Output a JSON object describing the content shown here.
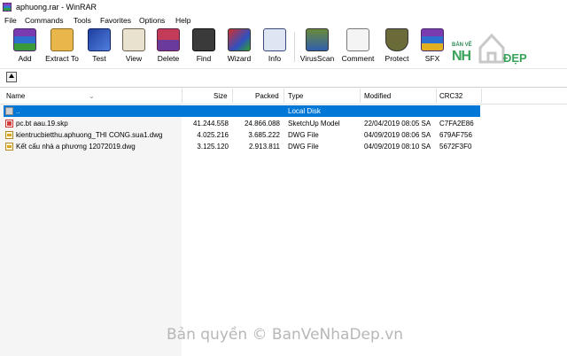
{
  "window": {
    "title": "aphuong.rar - WinRAR"
  },
  "menu": [
    "File",
    "Commands",
    "Tools",
    "Favorites",
    "Options",
    "Help"
  ],
  "toolbar": [
    {
      "label": "Add",
      "icon": "add-icon"
    },
    {
      "label": "Extract To",
      "icon": "extract-icon"
    },
    {
      "label": "Test",
      "icon": "test-icon"
    },
    {
      "label": "View",
      "icon": "view-icon"
    },
    {
      "label": "Delete",
      "icon": "delete-icon"
    },
    {
      "label": "Find",
      "icon": "find-icon"
    },
    {
      "label": "Wizard",
      "icon": "wizard-icon"
    },
    {
      "label": "Info",
      "icon": "info-icon"
    },
    {
      "label": "VirusScan",
      "icon": "virusscan-icon"
    },
    {
      "label": "Comment",
      "icon": "comment-icon"
    },
    {
      "label": "Protect",
      "icon": "protect-icon"
    },
    {
      "label": "SFX",
      "icon": "sfx-icon"
    }
  ],
  "columns": [
    "Name",
    "Size",
    "Packed",
    "Type",
    "Modified",
    "CRC32"
  ],
  "rows": [
    {
      "name": "..",
      "size": "",
      "packed": "",
      "type": "Local Disk",
      "modified": "",
      "crc": "",
      "selected": true
    },
    {
      "name": "pc.bt aau.19.skp",
      "size": "41.244.558",
      "packed": "24.866.088",
      "type": "SketchUp Model",
      "modified": "22/04/2019 08:05 SA",
      "crc": "C7FA2E86"
    },
    {
      "name": "kientrucbietthu.aphuong_THI CONG.sua1.dwg",
      "size": "4.025.216",
      "packed": "3.685.222",
      "type": "DWG File",
      "modified": "04/09/2019 08:06 SA",
      "crc": "679AF756"
    },
    {
      "name": "Kết cấu nhà a phương 12072019.dwg",
      "size": "3.125.120",
      "packed": "2.913.811",
      "type": "DWG File",
      "modified": "04/09/2019 08:10 SA",
      "crc": "5672F3F0"
    }
  ],
  "logo": {
    "line1": "BẢN VẼ",
    "line2": "NH",
    "line3": "ĐẸP"
  },
  "watermark": "Bản quyền © BanVeNhaDep.vn"
}
